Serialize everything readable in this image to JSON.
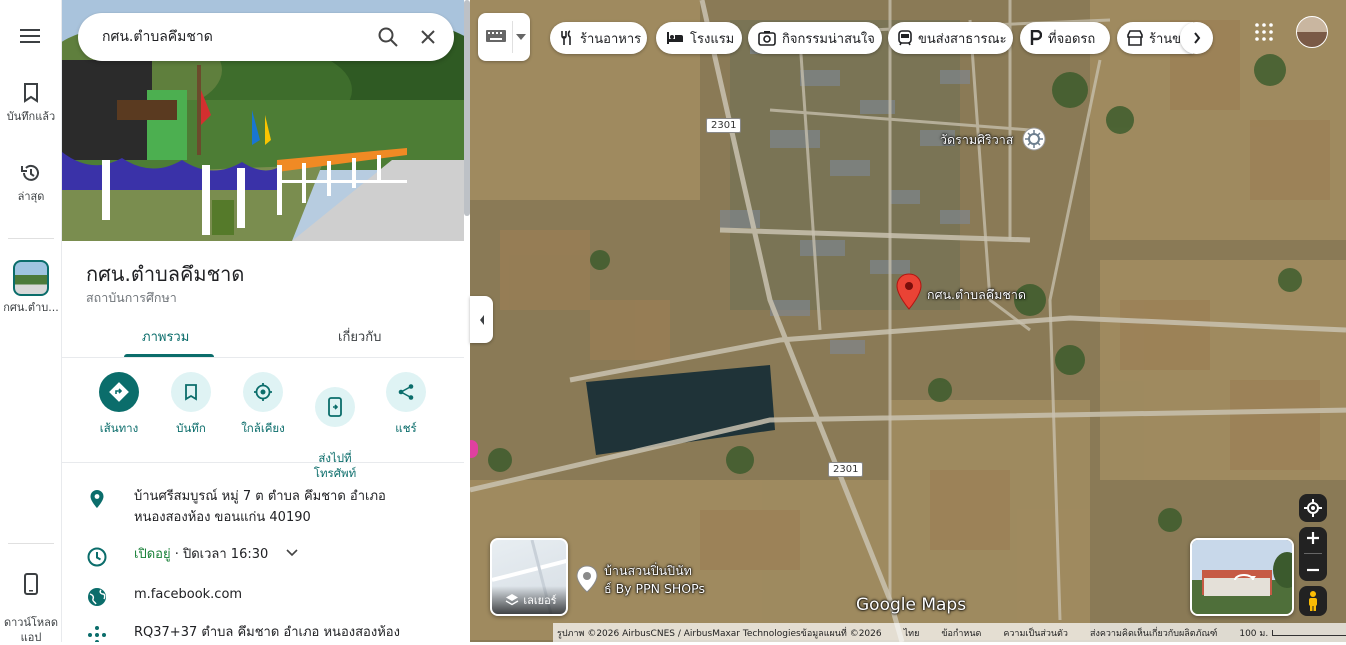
{
  "rail": {
    "menu_label": "",
    "saved_label": "บันทึกแล้ว",
    "recent_label": "ล่าสุด",
    "recent_place_label": "กศน.ตำบ...",
    "download_label": "ดาวน์โหลด\nแอป"
  },
  "search": {
    "value": "กศน.ตำบลคึมชาด"
  },
  "place": {
    "title": "กศน.ตำบลคึมชาด",
    "category": "สถาบันการศึกษา",
    "tabs": [
      "ภาพรวม",
      "เกี่ยวกับ"
    ],
    "actions": [
      {
        "label": "เส้นทาง",
        "icon": "directions-icon"
      },
      {
        "label": "บันทึก",
        "icon": "bookmark-icon"
      },
      {
        "label": "ใกล้เคียง",
        "icon": "nearby-icon"
      },
      {
        "label": "ส่งไปที่\nโทรศัพท์",
        "icon": "send-to-phone-icon"
      },
      {
        "label": "แชร์",
        "icon": "share-icon"
      }
    ],
    "address_line1": "บ้านศรีสมบูรณ์ หมู่ 7 ต ตำบล คึมชาด อำเภอ",
    "address_line2": "หนองสองห้อง ขอนแก่น 40190",
    "hours_open": "เปิดอยู่",
    "hours_close": " · ปิดเวลา 16:30",
    "website": "m.facebook.com",
    "plus_code": "RQ37+37 ตำบล คึมชาด อำเภอ หนองสองห้อง"
  },
  "map": {
    "chips": [
      {
        "label": "ร้านอาหาร",
        "icon": "restaurant-icon"
      },
      {
        "label": "โรงแรม",
        "icon": "hotel-icon"
      },
      {
        "label": "กิจกรรมน่าสนใจ",
        "icon": "camera-icon"
      },
      {
        "label": "ขนส่งสาธารณะ",
        "icon": "transit-icon"
      },
      {
        "label": "ที่จอดรถ",
        "icon": "parking-icon"
      },
      {
        "label": "ร้านขา",
        "icon": "store-icon"
      }
    ],
    "pin_label": "กศน.ตำบลคึมชาด",
    "temple_label": "วัดรามศิริวาส",
    "poi_label_line1": "บ้านสวนปิ่นปินัท",
    "poi_label_line2": "ธ์ By PPN SHOPs",
    "road_sign_1": "2301",
    "road_sign_2": "2301",
    "layers_label": "เลเยอร์",
    "watermark": "Google Maps",
    "footer": {
      "imagery": "รูปภาพ ©2026 AirbusCNES / AirbusMaxar Technologiesข้อมูลแผนที่ ©2026",
      "terms_1": "ไทย",
      "terms_2": "ข้อกำหนด",
      "terms_3": "ความเป็นส่วนตัว",
      "terms_4": "ส่งความคิดเห็นเกี่ยวกับผลิตภัณฑ์",
      "scale": "100 ม."
    }
  },
  "colors": {
    "accent": "#0b6d6b",
    "accent_light": "#dff3f4",
    "open_green": "#188038",
    "pin_red": "#ea4335"
  }
}
